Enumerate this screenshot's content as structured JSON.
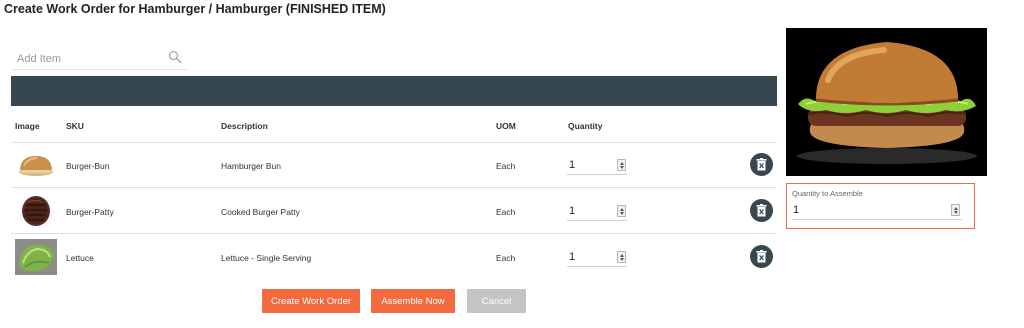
{
  "page": {
    "title": "Create Work Order for Hamburger / Hamburger (FINISHED ITEM)"
  },
  "search": {
    "placeholder": "Add Item",
    "icon": "search-icon"
  },
  "table": {
    "header_color": "#37474f",
    "columns": [
      "Image",
      "SKU",
      "Description",
      "UOM",
      "Quantity"
    ],
    "rows": [
      {
        "image": "burger-bun",
        "sku": "Burger-Bun",
        "description": "Hamburger Bun",
        "uom": "Each",
        "quantity": "1"
      },
      {
        "image": "burger-patty",
        "sku": "Burger-Patty",
        "description": "Cooked Burger Patty",
        "uom": "Each",
        "quantity": "1"
      },
      {
        "image": "lettuce",
        "sku": "Lettuce",
        "description": "Lettuce - Single Serving",
        "uom": "Each",
        "quantity": "1"
      }
    ]
  },
  "assemble": {
    "label": "Quantity to Assemble",
    "value": "1",
    "border_color": "#ef6c47"
  },
  "buttons": {
    "create": "Create Work Order",
    "assemble": "Assemble Now",
    "cancel": "Cancel",
    "accent": "#f46a3f"
  }
}
